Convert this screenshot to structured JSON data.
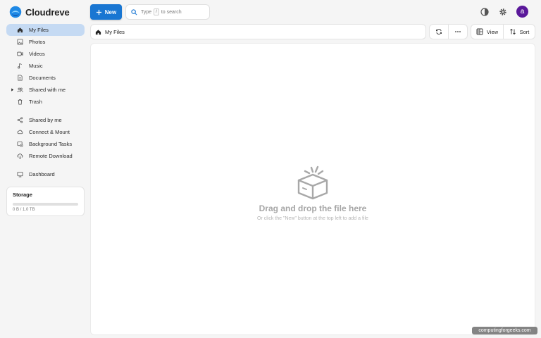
{
  "app": {
    "name": "Cloudreve"
  },
  "toolbar": {
    "new_label": "New",
    "search_prefix": "Type",
    "search_key": "/",
    "search_suffix": "to search",
    "view_label": "View",
    "sort_label": "Sort"
  },
  "user": {
    "avatar_letter": "a",
    "avatar_color": "#5a189a"
  },
  "sidebar": {
    "items": [
      {
        "label": "My Files",
        "icon": "home-icon",
        "active": true
      },
      {
        "label": "Photos",
        "icon": "image-icon"
      },
      {
        "label": "Videos",
        "icon": "video-icon"
      },
      {
        "label": "Music",
        "icon": "music-icon"
      },
      {
        "label": "Documents",
        "icon": "document-icon"
      },
      {
        "label": "Shared with me",
        "icon": "people-icon"
      },
      {
        "label": "Trash",
        "icon": "trash-icon"
      },
      {
        "label": "Shared by me",
        "icon": "share-icon"
      },
      {
        "label": "Connect & Mount",
        "icon": "cloud-link-icon"
      },
      {
        "label": "Background Tasks",
        "icon": "tasks-icon"
      },
      {
        "label": "Remote Download",
        "icon": "cloud-download-icon"
      },
      {
        "label": "Dashboard",
        "icon": "dashboard-icon"
      }
    ]
  },
  "storage": {
    "title": "Storage",
    "usage_text": "0 B / 1.0 TB",
    "used_fraction": 0
  },
  "breadcrumb": {
    "current": "My Files"
  },
  "empty_state": {
    "title": "Drag and drop the file here",
    "subtitle": "Or click the \"New\" button at the top left to add a file"
  },
  "watermark": "computingforgeeks.com",
  "colors": {
    "accent": "#1976d2",
    "active_nav": "#c5daf3",
    "background": "#f5f5f5"
  }
}
